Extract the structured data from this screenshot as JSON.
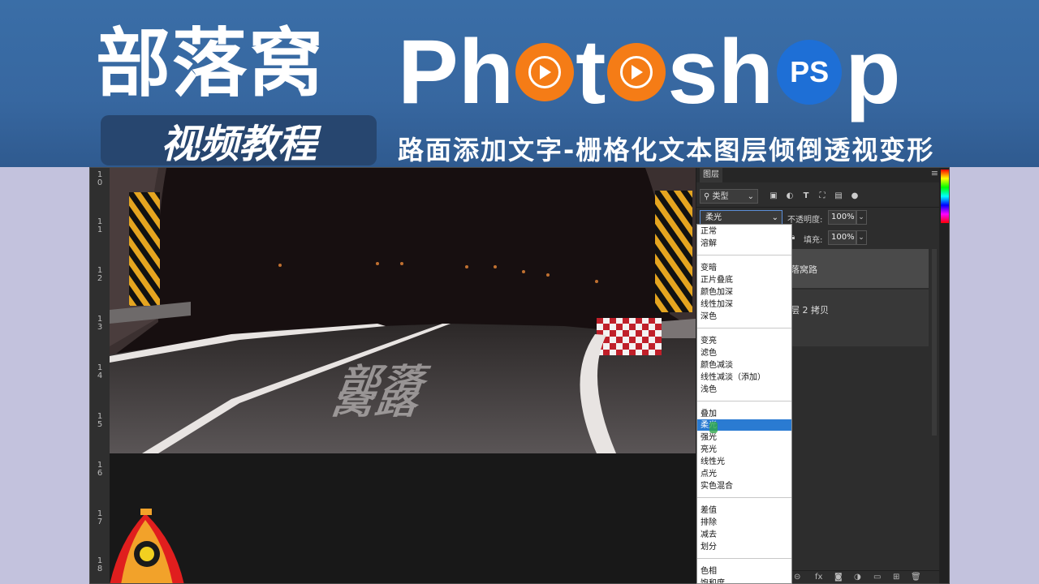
{
  "banner": {
    "brand_cn": "部落窝",
    "brand_en_parts": [
      "Ph",
      "t",
      "sh",
      "p"
    ],
    "ps_badge": "PS",
    "sub_box": "视频教程",
    "subtitle": "路面添加文字-栅格化文本图层倾倒透视变形",
    "colors": {
      "bg": "#3767a0",
      "orange": "#f57c16",
      "ps_blue": "#1e6fd6"
    }
  },
  "ruler": {
    "labels": [
      "1\n0",
      "1\n1",
      "1\n2",
      "1\n3",
      "1\n4",
      "1\n5",
      "1\n6",
      "1\n7",
      "1\n8"
    ]
  },
  "canvas": {
    "road_text": "部落窝路"
  },
  "layers_panel": {
    "tab": "图层",
    "menu_icon": "hamburger-icon",
    "filter_kind": "类型",
    "filter_icons": [
      "image-icon",
      "adjustment-icon",
      "type-icon",
      "shape-icon",
      "smart-object-icon",
      "toggle-icon"
    ],
    "blend_mode": "柔光",
    "opacity_label": "不透明度:",
    "opacity_value": "100%",
    "fill_label": "填充:",
    "fill_value": "100%",
    "layers": [
      {
        "name": "落窝路"
      },
      {
        "name": "层 2 拷贝"
      }
    ],
    "bottom_icons": [
      "link-icon",
      "fx-icon",
      "mask-icon",
      "adjustment-layer-icon",
      "folder-icon",
      "new-layer-icon",
      "trash-icon"
    ],
    "bottom_labels": [
      "⊝",
      "fx",
      "◙",
      "◑",
      "▭",
      "⊞",
      "🗑"
    ]
  },
  "blend_dropdown": {
    "groups": [
      [
        "正常",
        "溶解"
      ],
      [
        "变暗",
        "正片叠底",
        "颜色加深",
        "线性加深",
        "深色"
      ],
      [
        "变亮",
        "滤色",
        "颜色减淡",
        "线性减淡（添加）",
        "浅色"
      ],
      [
        "叠加",
        "柔光",
        "强光",
        "亮光",
        "线性光",
        "点光",
        "实色混合"
      ],
      [
        "差值",
        "排除",
        "减去",
        "划分"
      ],
      [
        "色相",
        "饱和度"
      ]
    ],
    "selected": "柔光"
  }
}
